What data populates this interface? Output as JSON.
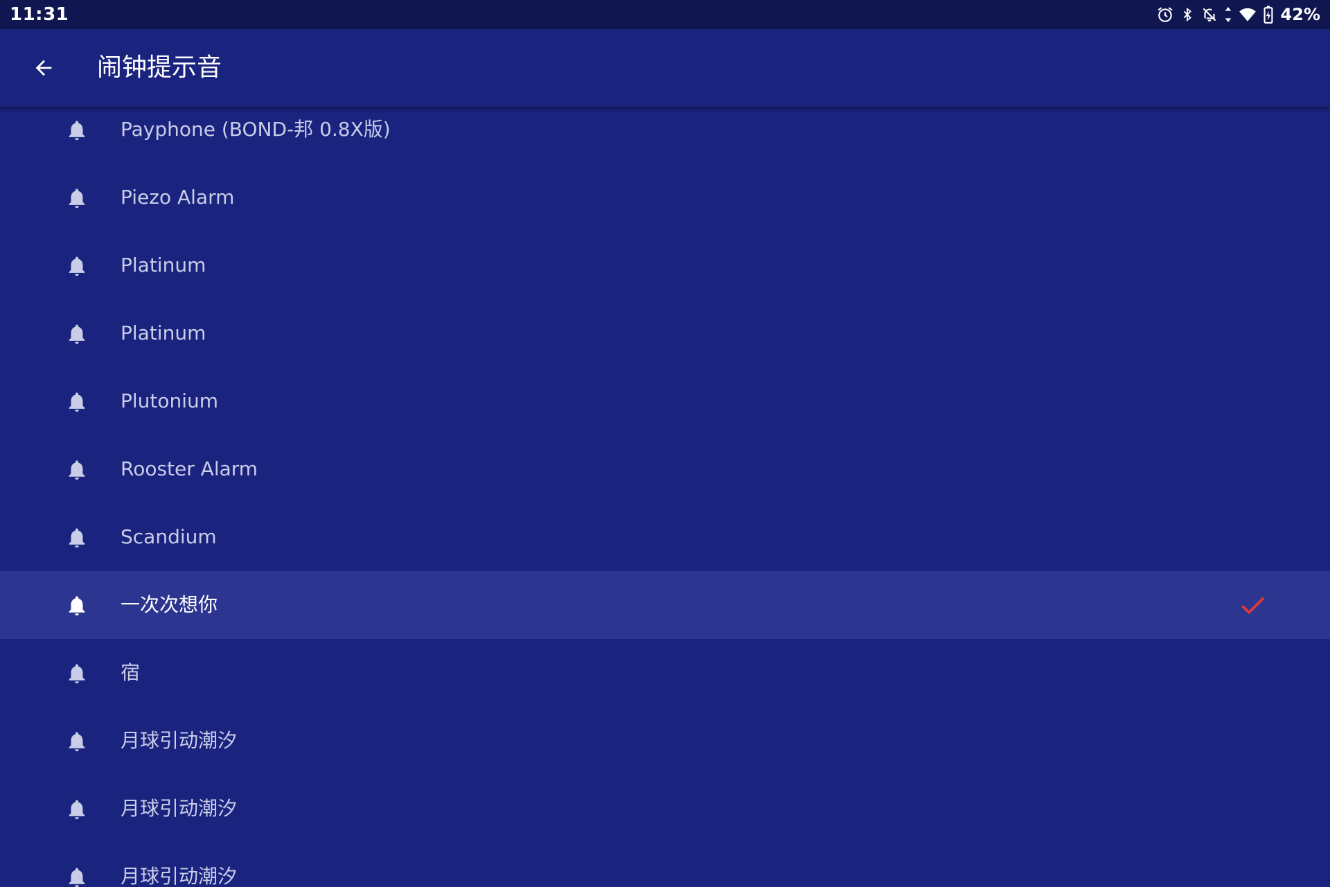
{
  "status_bar": {
    "time": "11:31",
    "battery": "42%",
    "icons": [
      "alarm-clock-icon",
      "bluetooth-icon",
      "notifications-off-icon",
      "data-arrows-icon",
      "wifi-icon",
      "battery-charging-icon"
    ]
  },
  "app_bar": {
    "back_icon": "arrow-left-icon",
    "title": "闹钟提示音"
  },
  "list": {
    "items": [
      {
        "label": "Payphone (BOND-邦 0.8X版)",
        "selected": false
      },
      {
        "label": "Piezo Alarm",
        "selected": false
      },
      {
        "label": "Platinum",
        "selected": false
      },
      {
        "label": "Platinum",
        "selected": false
      },
      {
        "label": "Plutonium",
        "selected": false
      },
      {
        "label": "Rooster Alarm",
        "selected": false
      },
      {
        "label": "Scandium",
        "selected": false
      },
      {
        "label": "一次次想你",
        "selected": true
      },
      {
        "label": "宿",
        "selected": false
      },
      {
        "label": "月球引动潮汐",
        "selected": false
      },
      {
        "label": "月球引动潮汐",
        "selected": false
      },
      {
        "label": "月球引动潮汐",
        "selected": false
      }
    ]
  },
  "colors": {
    "background": "#1a237e",
    "status_bar": "#0f1650",
    "selected_row": "#2c3590",
    "check_mark": "#e53935",
    "item_text": "#c9cde8"
  }
}
